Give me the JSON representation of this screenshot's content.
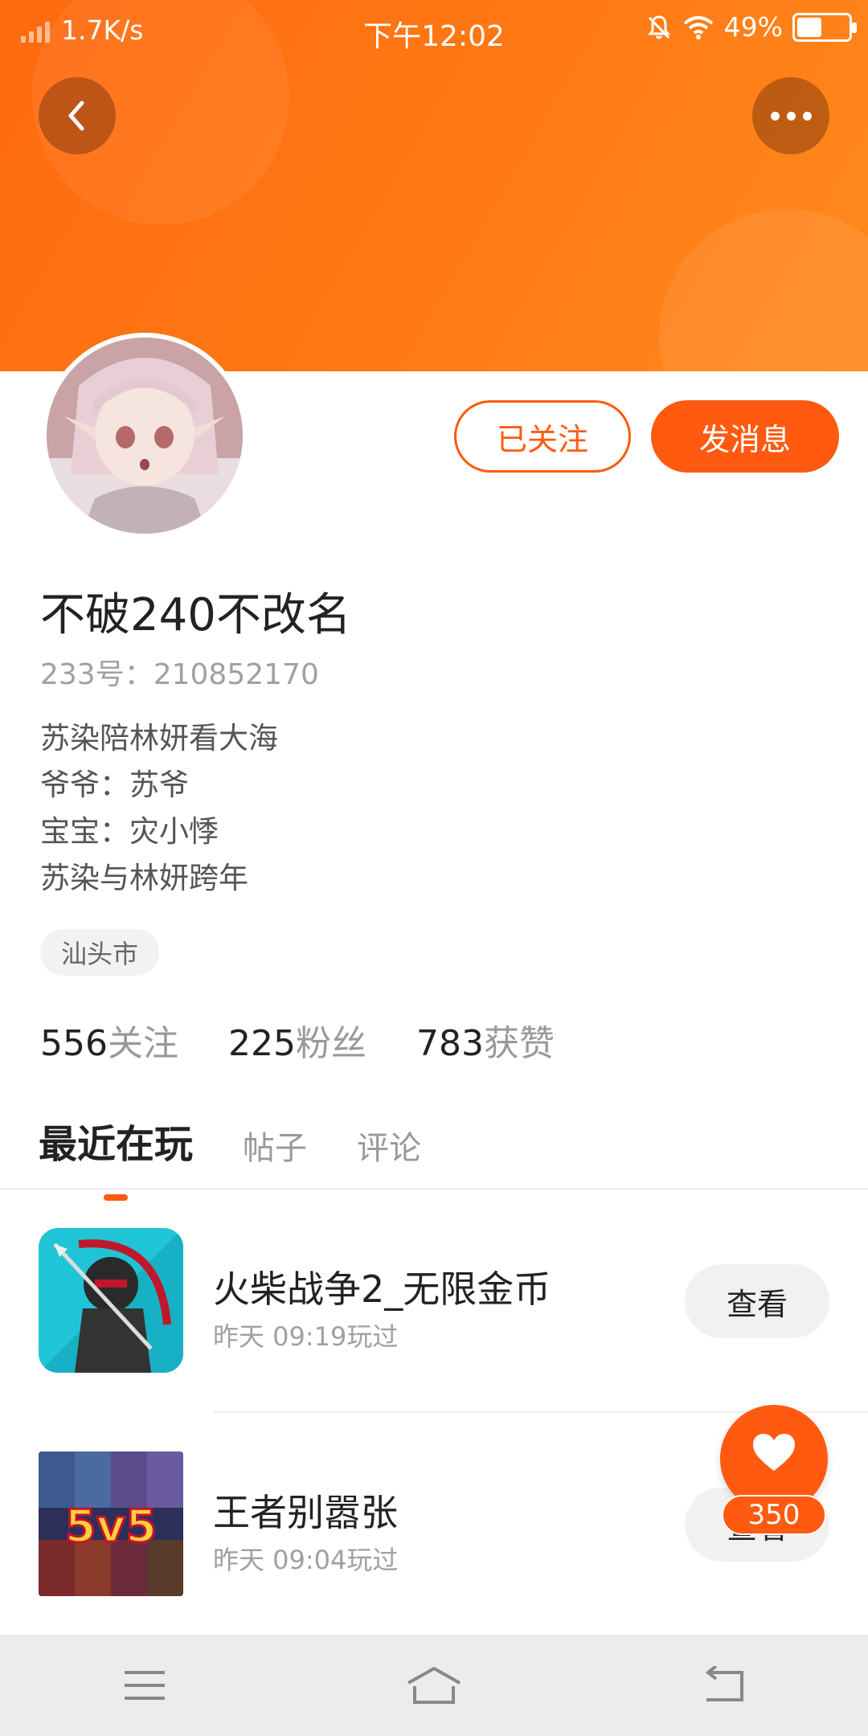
{
  "status_bar": {
    "net_speed": "1.7K/s",
    "time": "下午12:02",
    "battery": "49%",
    "battery_level": 0.49
  },
  "profile": {
    "followed_label": "已关注",
    "message_label": "发消息",
    "username": "不破240不改名",
    "user_id": "233号：210852170",
    "bio_lines": [
      "苏染陪林妍看大海",
      "爷爷：苏爷",
      "宝宝：灾小悸",
      "苏染与林妍跨年"
    ],
    "location": "汕头市"
  },
  "stats": [
    {
      "value": "556",
      "label": "关注"
    },
    {
      "value": "225",
      "label": "粉丝"
    },
    {
      "value": "783",
      "label": "获赞"
    }
  ],
  "tabs": [
    {
      "label": "最近在玩",
      "active": true
    },
    {
      "label": "帖子",
      "active": false
    },
    {
      "label": "评论",
      "active": false
    }
  ],
  "games": [
    {
      "name": "火柴战争2_无限金币",
      "played": "昨天 09:19玩过",
      "button": "查看",
      "icon": "stick-war-icon"
    },
    {
      "name": "王者别嚣张",
      "played": "昨天 09:04玩过",
      "button": "查看",
      "icon": "5v5-game-icon",
      "icon_text": "5v5"
    }
  ],
  "like": {
    "count": "350"
  },
  "colors": {
    "accent": "#ff5a10",
    "header": "#ff7a14"
  }
}
